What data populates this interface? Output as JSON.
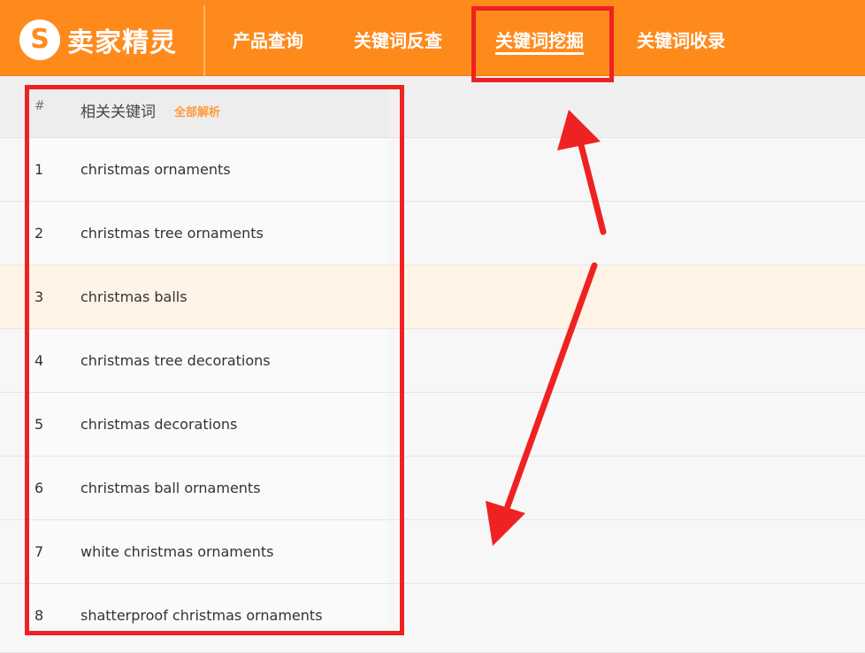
{
  "header": {
    "logo_mark": "S",
    "logo_text": "卖家精灵",
    "nav": [
      {
        "label": "产品查询",
        "active": false
      },
      {
        "label": "关键词反查",
        "active": false
      },
      {
        "label": "关键词挖掘",
        "active": true
      },
      {
        "label": "关键词收录",
        "active": false
      }
    ]
  },
  "table": {
    "columns": {
      "num": "#",
      "keyword": "相关关键词",
      "tip": "全部解析"
    },
    "rows": [
      {
        "num": "1",
        "keyword": "christmas ornaments"
      },
      {
        "num": "2",
        "keyword": "christmas tree ornaments"
      },
      {
        "num": "3",
        "keyword": "christmas balls"
      },
      {
        "num": "4",
        "keyword": "christmas tree decorations"
      },
      {
        "num": "5",
        "keyword": "christmas decorations"
      },
      {
        "num": "6",
        "keyword": "christmas ball ornaments"
      },
      {
        "num": "7",
        "keyword": "white christmas ornaments"
      },
      {
        "num": "8",
        "keyword": "shatterproof christmas ornaments"
      }
    ]
  },
  "colors": {
    "brand_orange": "#ff8a1c",
    "highlight_red": "#ee2222",
    "row_hover": "#fff3e6"
  }
}
